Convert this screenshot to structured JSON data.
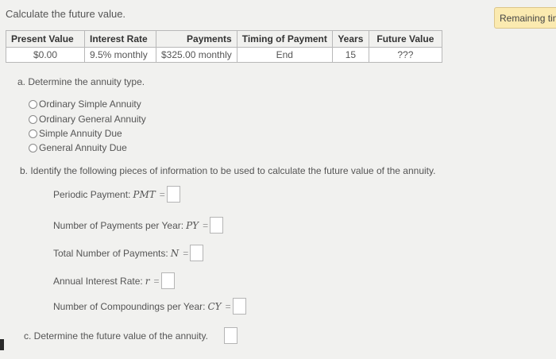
{
  "question": {
    "title": "Calculate the future value."
  },
  "timer": {
    "label": "Remaining time"
  },
  "table": {
    "headers": [
      "Present Value",
      "Interest Rate",
      "Payments",
      "Timing of Payment",
      "Years",
      "Future Value"
    ],
    "row": [
      "$0.00",
      "9.5% monthly",
      "$325.00 monthly",
      "End",
      "15",
      "???"
    ]
  },
  "part_a": {
    "prompt": "a. Determine the annuity type.",
    "options": [
      "Ordinary Simple Annuity",
      "Ordinary General Annuity",
      "Simple Annuity Due",
      "General Annuity Due"
    ]
  },
  "part_b": {
    "prompt": "b. Identify the following pieces of information to be used to calculate the future value of the annuity.",
    "fields": [
      {
        "label": "Periodic Payment:",
        "symbol": "PMT",
        "eq": "="
      },
      {
        "label": "Number of Payments per Year:",
        "symbol": "PY",
        "eq": "="
      },
      {
        "label": "Total Number of Payments:",
        "symbol": "N",
        "eq": "="
      },
      {
        "label": "Annual Interest Rate:",
        "symbol": "r",
        "eq": "="
      },
      {
        "label": "Number of Compoundings per Year:",
        "symbol": "CY",
        "eq": "="
      }
    ]
  },
  "part_c": {
    "prompt": "c. Determine the future value of the annuity."
  }
}
